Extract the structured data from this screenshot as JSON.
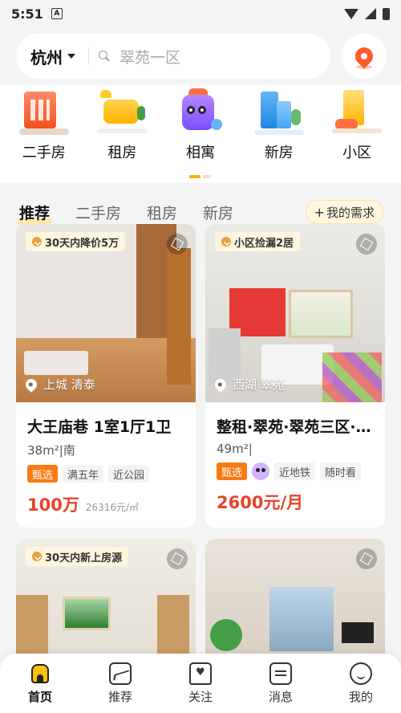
{
  "status_bar": {
    "time": "5:51",
    "notification_icon": "A"
  },
  "search": {
    "city": "杭州",
    "placeholder": "翠苑一区"
  },
  "categories": [
    {
      "label": "二手房",
      "icon": "red-building-icon"
    },
    {
      "label": "租房",
      "icon": "sofa-icon"
    },
    {
      "label": "相寓",
      "icon": "mascot-bag-icon"
    },
    {
      "label": "新房",
      "icon": "blue-building-icon"
    },
    {
      "label": "小区",
      "icon": "yellow-building-icon"
    }
  ],
  "tabs": [
    "推荐",
    "二手房",
    "租房",
    "新房"
  ],
  "need_button": "我的需求",
  "listings": [
    {
      "badge": "30天内降价5万",
      "location": "上城 清泰",
      "title": "大王庙巷 1室1厅1卫",
      "meta": "38m²|南",
      "tags": [
        "甄选",
        "满五年",
        "近公园"
      ],
      "price": "100万",
      "unit_price": "26316元/㎡"
    },
    {
      "badge": "小区捡漏2居",
      "location": "西湖 翠苑",
      "title": "整租·翠苑·翠苑三区·2...",
      "meta": "49m²|",
      "tags": [
        "甄选",
        "近地铁",
        "随时看"
      ],
      "price": "2600元/月",
      "unit_price": ""
    },
    {
      "badge": "30天内新上房源"
    },
    {
      "badge": ""
    }
  ],
  "bottom_nav": [
    {
      "label": "首页",
      "active": true
    },
    {
      "label": "推荐"
    },
    {
      "label": "关注"
    },
    {
      "label": "消息"
    },
    {
      "label": "我的"
    }
  ],
  "colors": {
    "accent": "#f5b400",
    "price": "#e8432a",
    "highlight_tag": "#fa7a12"
  }
}
